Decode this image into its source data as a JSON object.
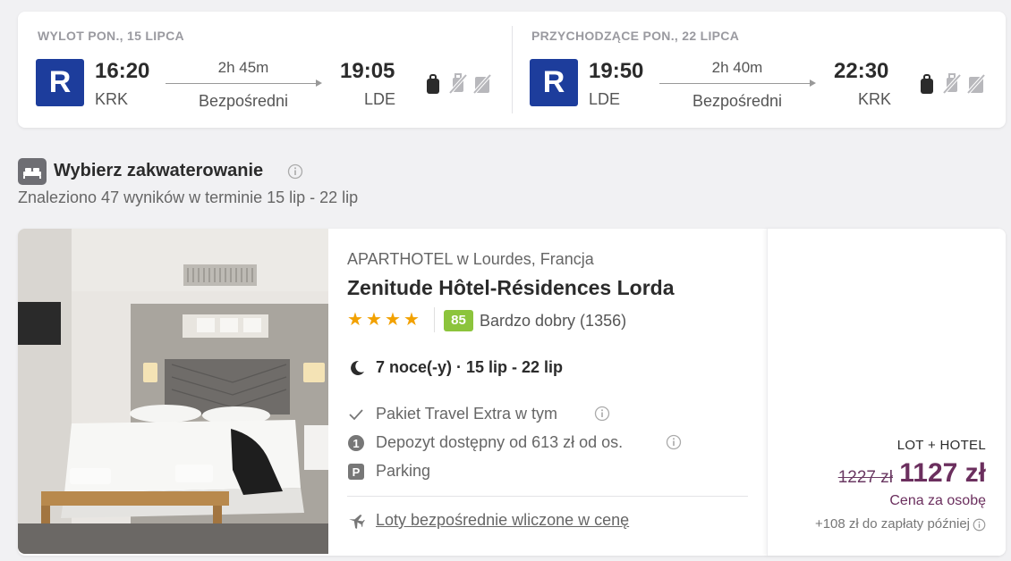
{
  "flights": {
    "outbound": {
      "title": "WYLOT PON., 15 LIPCA",
      "airline_logo": "R",
      "dep_time": "16:20",
      "dep_code": "KRK",
      "duration": "2h 45m",
      "stops": "Bezpośredni",
      "arr_time": "19:05",
      "arr_code": "LDE",
      "baggage_icons": [
        "personal-bag-icon",
        "cabin-bag-not-included-icon",
        "checked-bag-not-included-icon"
      ]
    },
    "inbound": {
      "title": "PRZYCHODZĄCE PON., 22 LIPCA",
      "airline_logo": "R",
      "dep_time": "19:50",
      "dep_code": "LDE",
      "duration": "2h 40m",
      "stops": "Bezpośredni",
      "arr_time": "22:30",
      "arr_code": "KRK",
      "baggage_icons": [
        "personal-bag-icon",
        "cabin-bag-not-included-icon",
        "checked-bag-not-included-icon"
      ]
    },
    "airline_color": "#1d3d9c"
  },
  "accommodation": {
    "title": "Wybierz zakwaterowanie",
    "subtitle": "Znaleziono 47 wyników w terminie 15 lip - 22 lip"
  },
  "hotel": {
    "type": "APARTHOTEL w Lourdes, Francja",
    "name": "Zenitude Hôtel-Résidences Lorda",
    "stars": 4,
    "score": "85",
    "score_label": "Bardzo dobry (1356)",
    "nights": "7 noce(-y) · 15 lip - 22 lip",
    "features": [
      {
        "icon": "check-icon",
        "text": "Pakiet Travel Extra w tym"
      },
      {
        "icon": "deposit-icon",
        "text": "Depozyt dostępny od 613 zł od os."
      },
      {
        "icon": "parking-icon",
        "text": "Parking"
      }
    ],
    "flights_included": "Loty bezpośrednie wliczone w cenę",
    "price": {
      "label": "LOT + HOTEL",
      "old": "1227 zł",
      "new": "1127 zł",
      "per_person": "Cena za osobę",
      "extra": "+108 zł do zapłaty później"
    },
    "score_color": "#8cc43c",
    "price_color": "#6b2f5e",
    "star_color": "#f2a100"
  }
}
